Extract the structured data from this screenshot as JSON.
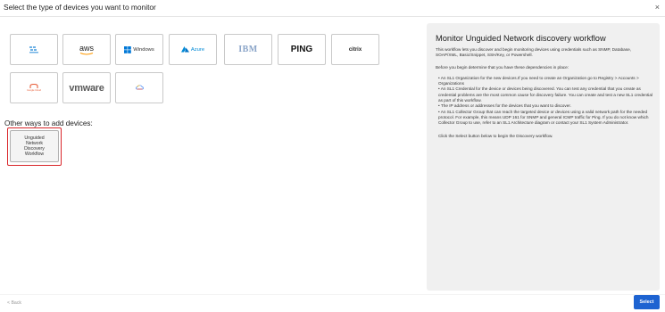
{
  "header": {
    "title": "Select the type of devices you want to monitor",
    "close_label": "×"
  },
  "tiles": [
    {
      "id": "vmware-tanzu",
      "label": "",
      "icon": "vmware-tanzu-logo"
    },
    {
      "id": "aws",
      "label": "aws",
      "icon": "aws-logo"
    },
    {
      "id": "windows",
      "label": "Windows",
      "icon": "windows-logo"
    },
    {
      "id": "azure",
      "label": "Azure",
      "icon": "azure-logo"
    },
    {
      "id": "ibm",
      "label": "IBM",
      "icon": "ibm-logo"
    },
    {
      "id": "ping",
      "label": "PING",
      "icon": "ping-text"
    },
    {
      "id": "citrix",
      "label": "citrix",
      "icon": "citrix-logo"
    },
    {
      "id": "google-cloud",
      "label": "Google Cloud",
      "icon": "google-cloud-logo"
    },
    {
      "id": "vmware",
      "label": "vmware",
      "icon": "vmware-logo"
    },
    {
      "id": "gcp-alt",
      "label": "",
      "icon": "gcp-logo"
    }
  ],
  "other_ways": {
    "heading": "Other ways to add devices:",
    "udw_lines": [
      "Unguided",
      "Network",
      "Discovery",
      "Workflow"
    ]
  },
  "panel": {
    "title": "Monitor Unguided Network discovery workflow",
    "intro": "This workflow lets you discover and begin monitoring devices using credentials such as SNMP, Database, SOAP/XML, Basic/Snippet, SSH/Key, or Powershell.",
    "deps": "Before you begin determine that you have these dependencies in place:",
    "bullets": [
      "An SL1 Organization for the new devices.If you need to create an Organization go to Registry > Accounts > Organizations",
      "An SL1 Credential for the device or devices being discovered. You can test any credential that you create as credential problems are the most common cause for discovery failure. You can create and test a new SL1 credential as part of this workflow.",
      "The IP address or addresses for the devices that you want to discover.",
      "An SL1 Collector Group that can reach the targeted device or devices using a valid network path for the needed protocol. For example, this means UDP 161 for SNMP and general ICMP traffic for Ping. If you do not know which Collector Group to use, refer to an SL1 Architecture diagram or contact your SL1 System Administrator."
    ],
    "select_note": "Click the Select button below to begin the Discovery workflow."
  },
  "footer": {
    "back_label": "< Back",
    "select_label": "Select"
  },
  "colors": {
    "accent": "#1d63d1",
    "highlight": "#d9262a",
    "panel_bg": "#f0f0f0"
  }
}
